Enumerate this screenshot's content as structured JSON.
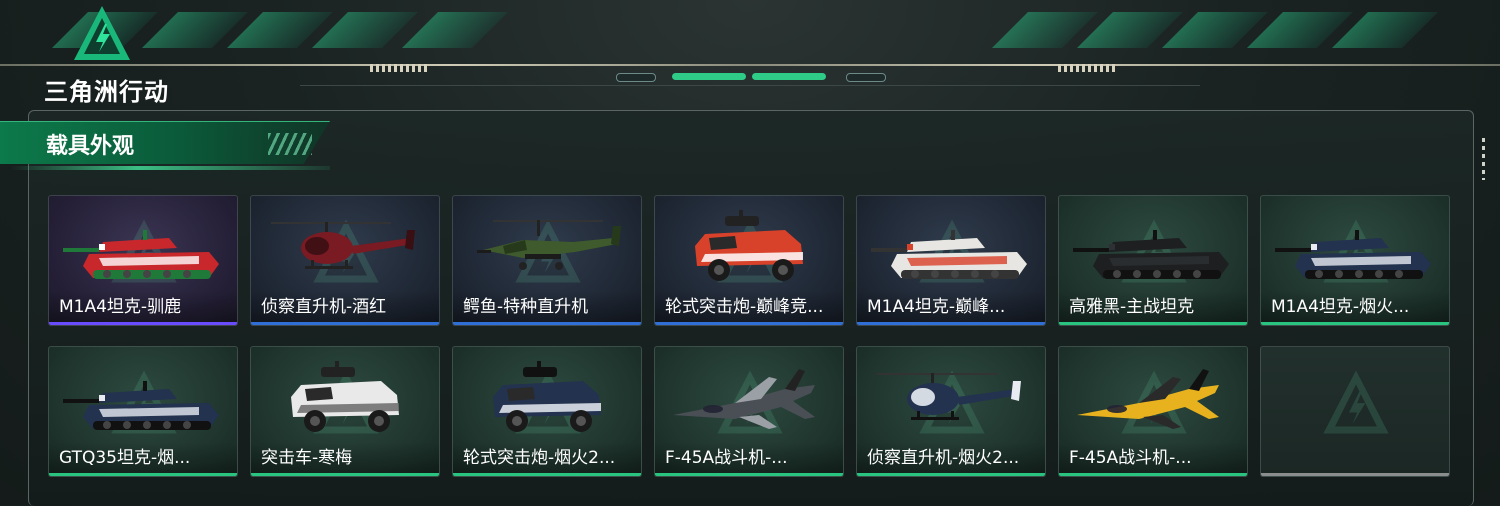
{
  "header": {
    "game_logo_text": "三角洲行动"
  },
  "section": {
    "title": "载具外观"
  },
  "colors": {
    "accent_green": "#2ecc86",
    "rarity_purple": "#6a4cff",
    "rarity_blue": "#2f6fd6",
    "rarity_green": "#29c47f",
    "rarity_gray": "#8a8f8d"
  },
  "skins": [
    {
      "name": "M1A4坦克-驯鹿",
      "rarity": "purple",
      "vehicle": "tank",
      "palette": [
        "#c8282c",
        "#ffffff",
        "#1f7a3a"
      ]
    },
    {
      "name": "侦察直升机-酒红",
      "rarity": "blue",
      "vehicle": "helicopter-small",
      "palette": [
        "#7a1a22",
        "#3a0f14",
        "#222"
      ]
    },
    {
      "name": "鳄鱼-特种直升机",
      "rarity": "blue",
      "vehicle": "attack-helicopter",
      "palette": [
        "#3f5a2c",
        "#263a1b",
        "#1b1b1b"
      ]
    },
    {
      "name": "轮式突击炮-巅峰竞...",
      "rarity": "blue",
      "vehicle": "armored-car",
      "palette": [
        "#d8412a",
        "#ffffff",
        "#222"
      ]
    },
    {
      "name": "M1A4坦克-巅峰...",
      "rarity": "blue",
      "vehicle": "tank",
      "palette": [
        "#e8e6e2",
        "#d8412a",
        "#333"
      ]
    },
    {
      "name": "高雅黑-主战坦克",
      "rarity": "green",
      "vehicle": "tank",
      "palette": [
        "#1d1f20",
        "#2e3133",
        "#111"
      ]
    },
    {
      "name": "M1A4坦克-烟火...",
      "rarity": "green",
      "vehicle": "tank",
      "palette": [
        "#22324f",
        "#e8ecf2",
        "#111"
      ]
    },
    {
      "name": "GTQ35坦克-烟...",
      "rarity": "green",
      "vehicle": "tank",
      "palette": [
        "#22324f",
        "#e8ecf2",
        "#111"
      ]
    },
    {
      "name": "突击车-寒梅",
      "rarity": "green",
      "vehicle": "armored-car",
      "palette": [
        "#e9e9e9",
        "#6a6a6a",
        "#222"
      ]
    },
    {
      "name": "轮式突击炮-烟火2...",
      "rarity": "green",
      "vehicle": "armored-car",
      "palette": [
        "#22324f",
        "#e8ecf2",
        "#111"
      ]
    },
    {
      "name": "F-45A战斗机-...",
      "rarity": "green",
      "vehicle": "jet",
      "palette": [
        "#4a4f55",
        "#9aa0a6",
        "#222"
      ]
    },
    {
      "name": "侦察直升机-烟火2...",
      "rarity": "green",
      "vehicle": "helicopter-small",
      "palette": [
        "#22324f",
        "#e8ecf2",
        "#111"
      ]
    },
    {
      "name": "F-45A战斗机-...",
      "rarity": "green",
      "vehicle": "jet",
      "palette": [
        "#e8b21e",
        "#2a2a2a",
        "#111"
      ]
    },
    {
      "name": "",
      "rarity": "gray",
      "vehicle": "empty",
      "palette": []
    }
  ]
}
